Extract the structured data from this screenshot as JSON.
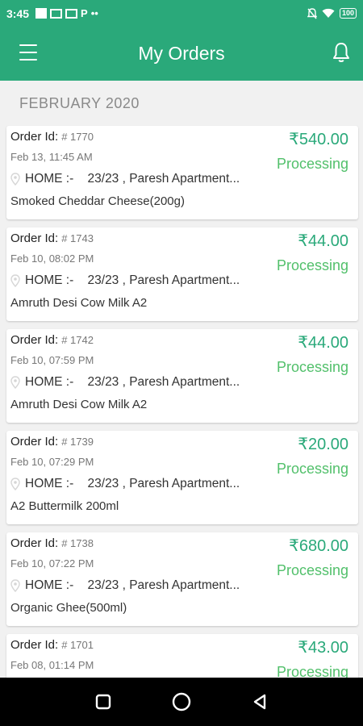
{
  "status_bar": {
    "time": "3:45",
    "left_icons": [
      "notification-icon",
      "gmail-icon",
      "gmail-icon",
      "paytm-icon",
      "more-dots-icon"
    ],
    "p_glyph": "P",
    "dots": "••",
    "battery": "100"
  },
  "app_bar": {
    "title": "My Orders"
  },
  "section": {
    "month": "FEBRUARY 2020"
  },
  "orders": [
    {
      "label": "Order Id:",
      "id": "# 1770",
      "date": "Feb 13, 11:45 AM",
      "address_tag": "HOME :-",
      "address": "23/23 , Paresh Apartment...",
      "product": "Smoked Cheddar Cheese(200g)",
      "amount": "₹540.00",
      "status": "Processing"
    },
    {
      "label": "Order Id:",
      "id": "# 1743",
      "date": "Feb 10, 08:02 PM",
      "address_tag": "HOME :-",
      "address": "23/23 , Paresh Apartment...",
      "product": "Amruth Desi Cow Milk A2",
      "amount": "₹44.00",
      "status": "Processing"
    },
    {
      "label": "Order Id:",
      "id": "# 1742",
      "date": "Feb 10, 07:59 PM",
      "address_tag": "HOME :-",
      "address": "23/23 , Paresh Apartment...",
      "product": "Amruth Desi Cow Milk A2",
      "amount": "₹44.00",
      "status": "Processing"
    },
    {
      "label": "Order Id:",
      "id": "# 1739",
      "date": "Feb 10, 07:29 PM",
      "address_tag": "HOME :-",
      "address": "23/23 , Paresh Apartment...",
      "product": "A2 Buttermilk 200ml",
      "amount": "₹20.00",
      "status": "Processing"
    },
    {
      "label": "Order Id:",
      "id": "# 1738",
      "date": "Feb 10, 07:22 PM",
      "address_tag": "HOME :-",
      "address": "23/23 , Paresh Apartment...",
      "product": "Organic Ghee(500ml)",
      "amount": "₹680.00",
      "status": "Processing"
    },
    {
      "label": "Order Id:",
      "id": "# 1701",
      "date": "Feb 08, 01:14 PM",
      "address_tag": "",
      "address": "",
      "product": "",
      "amount": "₹43.00",
      "status": "Processing"
    }
  ],
  "nav_bar": {
    "buttons": [
      "recents-square-icon",
      "home-circle-icon",
      "back-triangle-icon"
    ]
  },
  "colors": {
    "primary": "#2aa97a",
    "status_green": "#52c06b",
    "background": "#f1f1f1"
  }
}
